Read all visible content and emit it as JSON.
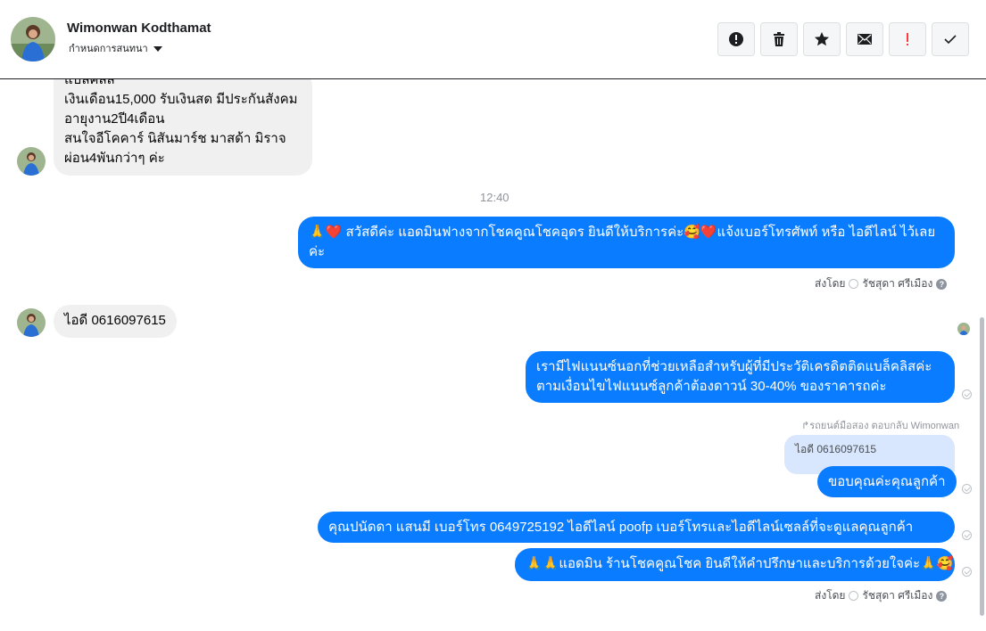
{
  "header": {
    "contact_name": "Wimonwan Kodthamat",
    "assign_label": "กำหนดการสนทนา",
    "actions": [
      {
        "name": "mark-spam-button",
        "icon": "alert-circle-icon"
      },
      {
        "name": "delete-button",
        "icon": "trash-icon"
      },
      {
        "name": "star-button",
        "icon": "star-icon"
      },
      {
        "name": "mark-unread-button",
        "icon": "envelope-icon"
      },
      {
        "name": "follow-up-button",
        "icon": "exclamation-icon",
        "color": "#fa3e3e"
      },
      {
        "name": "mark-done-button",
        "icon": "check-icon"
      }
    ]
  },
  "messages": {
    "incoming_1": {
      "lines": [
        "แบล็คลิส",
        "เงินเดือน15,000  รับเงินสด มีประกันสังคม",
        "อายุงาน2ปี4เดือน",
        "สนใจอีโคคาร์  นิสันมาร์ช  มาสด้า  มิราจ",
        "ผ่อน4พันกว่าๆ ค่ะ"
      ]
    },
    "timestamp": "12:40",
    "outgoing_1": {
      "line1": "🙏❤️ สวัสดีค่ะ แอดมินฟางจากโชคคูณโชคอุดร ยินดีให้บริการค่ะ🥰❤️แจ้งเบอร์โทรศัพท์ หรือ ไอดีไลน์  ไว้เลย",
      "line2": "ค่ะ"
    },
    "sent_by_1": {
      "prefix": "ส่งโดย",
      "name": "รัชสุดา ศรีเมือง"
    },
    "incoming_2": {
      "text": "ไอดี 0616097615"
    },
    "outgoing_2": {
      "line1": "เรามีไฟแนนซ์นอกที่ช่วยเหลือสำหรับผู้ที่มีประวัติเครดิตติดแบล็คลิสค่ะ",
      "line2": "ตามเงื่อนไขไฟแนนซ์ลูกค้าต้องดาวน์ 30-40% ของราคารถค่ะ"
    },
    "reply_note": "↱รถยนต์มือสอง ตอบกลับ Wimonwan",
    "quoted": {
      "text": "ไอดี 0616097615"
    },
    "outgoing_3": {
      "text": "ขอบคุณค่ะคุณลูกค้า"
    },
    "outgoing_4": {
      "text": "คุณปนัดดา แสนมี    เบอร์โทร 0649725192  ไอดีไลน์ poofp    เบอร์โทรและไอดีไลน์เซลล์ที่จะดูแลคุณลูกค้า"
    },
    "outgoing_5": {
      "text": "🙏🙏แอดมิน ร้านโชคคูณโชค ยินดีให้คำปรึกษาและบริการด้วยใจค่ะ🙏🥰"
    },
    "sent_by_2": {
      "prefix": "ส่งโดย",
      "name": "รัชสุดา ศรีเมือง"
    }
  },
  "colors": {
    "outgoing_bubble": "#0a7cff",
    "incoming_bubble": "#f0f0f0",
    "quote_bubble": "#d8e7fd"
  }
}
